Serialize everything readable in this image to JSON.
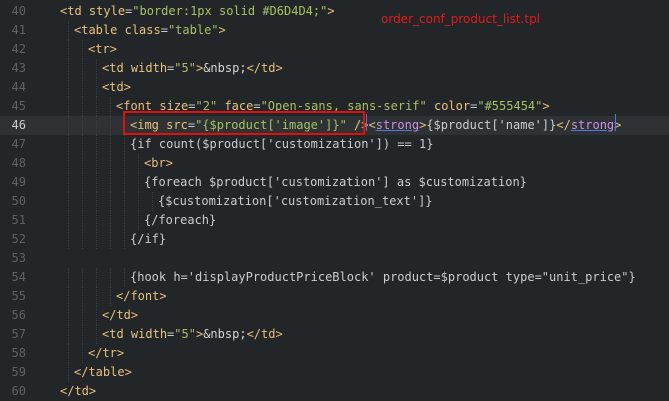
{
  "editor": {
    "filename": "order_conf_product_list.tpl",
    "active_line": 46,
    "lines": [
      {
        "num": "40",
        "indent": 1,
        "tokens": [
          [
            "p",
            "<"
          ],
          [
            "g",
            "td"
          ],
          [
            "c",
            " "
          ],
          [
            "a",
            "style"
          ],
          [
            "c",
            "="
          ],
          [
            "s",
            "\"border:1px solid #D6D4D4;\""
          ],
          [
            "p",
            ">"
          ]
        ]
      },
      {
        "num": "41",
        "indent": 2,
        "tokens": [
          [
            "p",
            "<"
          ],
          [
            "g",
            "table"
          ],
          [
            "c",
            " "
          ],
          [
            "a",
            "class"
          ],
          [
            "c",
            "="
          ],
          [
            "s",
            "\"table\""
          ],
          [
            "p",
            ">"
          ]
        ]
      },
      {
        "num": "42",
        "indent": 3,
        "tokens": [
          [
            "p",
            "<"
          ],
          [
            "g",
            "tr"
          ],
          [
            "p",
            ">"
          ]
        ]
      },
      {
        "num": "43",
        "indent": 4,
        "tokens": [
          [
            "p",
            "<"
          ],
          [
            "g",
            "td"
          ],
          [
            "c",
            " "
          ],
          [
            "a",
            "width"
          ],
          [
            "c",
            "="
          ],
          [
            "s",
            "\"5\""
          ],
          [
            "p",
            ">"
          ],
          [
            "e",
            "&nbsp;"
          ],
          [
            "p",
            "</"
          ],
          [
            "g",
            "td"
          ],
          [
            "p",
            ">"
          ]
        ]
      },
      {
        "num": "44",
        "indent": 4,
        "tokens": [
          [
            "p",
            "<"
          ],
          [
            "g",
            "td"
          ],
          [
            "p",
            ">"
          ]
        ]
      },
      {
        "num": "45",
        "indent": 5,
        "tokens": [
          [
            "p",
            "<"
          ],
          [
            "g",
            "font"
          ],
          [
            "c",
            " "
          ],
          [
            "a",
            "size"
          ],
          [
            "c",
            "="
          ],
          [
            "s",
            "\"2\""
          ],
          [
            "c",
            " "
          ],
          [
            "a",
            "face"
          ],
          [
            "c",
            "="
          ],
          [
            "s",
            "\"Open-sans, sans-serif\""
          ],
          [
            "c",
            " "
          ],
          [
            "a",
            "color"
          ],
          [
            "c",
            "="
          ],
          [
            "s",
            "\"#555454\""
          ],
          [
            "p",
            ">"
          ]
        ]
      },
      {
        "num": "46",
        "indent": 6,
        "tokens": [
          [
            "p",
            "<"
          ],
          [
            "g",
            "img"
          ],
          [
            "c",
            " "
          ],
          [
            "a",
            "src"
          ],
          [
            "c",
            "="
          ],
          [
            "s",
            "\"{$product['image']}\""
          ],
          [
            "c",
            " "
          ],
          [
            "p",
            "/>"
          ],
          [
            "p",
            "<"
          ],
          [
            "k",
            "strong"
          ],
          [
            "p",
            ">"
          ],
          [
            "c",
            "{$product['name']}"
          ],
          [
            "p",
            "</"
          ],
          [
            "k",
            "strong"
          ],
          [
            "p",
            ">"
          ]
        ]
      },
      {
        "num": "47",
        "indent": 6,
        "tokens": [
          [
            "c",
            "{if count($product['customization']) == 1}"
          ]
        ]
      },
      {
        "num": "48",
        "indent": 7,
        "tokens": [
          [
            "p",
            "<"
          ],
          [
            "g",
            "br"
          ],
          [
            "p",
            ">"
          ]
        ]
      },
      {
        "num": "49",
        "indent": 7,
        "tokens": [
          [
            "c",
            "{foreach $product['customization'] as $customization}"
          ]
        ]
      },
      {
        "num": "50",
        "indent": 8,
        "tokens": [
          [
            "c",
            "{$customization['customization_text']}"
          ]
        ]
      },
      {
        "num": "51",
        "indent": 7,
        "tokens": [
          [
            "c",
            "{/foreach}"
          ]
        ]
      },
      {
        "num": "52",
        "indent": 6,
        "tokens": [
          [
            "c",
            "{/if}"
          ]
        ]
      },
      {
        "num": "53",
        "indent": 0,
        "tokens": []
      },
      {
        "num": "54",
        "indent": 6,
        "tokens": [
          [
            "c",
            "{hook h='displayProductPriceBlock' product=$product type=\"unit_price\"}"
          ]
        ]
      },
      {
        "num": "55",
        "indent": 5,
        "tokens": [
          [
            "p",
            "</"
          ],
          [
            "g",
            "font"
          ],
          [
            "p",
            ">"
          ]
        ]
      },
      {
        "num": "56",
        "indent": 4,
        "tokens": [
          [
            "p",
            "</"
          ],
          [
            "g",
            "td"
          ],
          [
            "p",
            ">"
          ]
        ]
      },
      {
        "num": "57",
        "indent": 4,
        "tokens": [
          [
            "p",
            "<"
          ],
          [
            "g",
            "td"
          ],
          [
            "c",
            " "
          ],
          [
            "a",
            "width"
          ],
          [
            "c",
            "="
          ],
          [
            "s",
            "\"5\""
          ],
          [
            "p",
            ">"
          ],
          [
            "e",
            "&nbsp;"
          ],
          [
            "p",
            "</"
          ],
          [
            "g",
            "td"
          ],
          [
            "p",
            ">"
          ]
        ]
      },
      {
        "num": "58",
        "indent": 3,
        "tokens": [
          [
            "p",
            "</"
          ],
          [
            "g",
            "tr"
          ],
          [
            "p",
            ">"
          ]
        ]
      },
      {
        "num": "59",
        "indent": 2,
        "tokens": [
          [
            "p",
            "</"
          ],
          [
            "g",
            "table"
          ],
          [
            "p",
            ">"
          ]
        ]
      },
      {
        "num": "60",
        "indent": 1,
        "tokens": [
          [
            "p",
            "</"
          ],
          [
            "g",
            "td"
          ],
          [
            "p",
            ">"
          ]
        ]
      }
    ]
  },
  "annotation": {
    "highlight_color": "#e01010",
    "label_color": "#e31b1b"
  }
}
